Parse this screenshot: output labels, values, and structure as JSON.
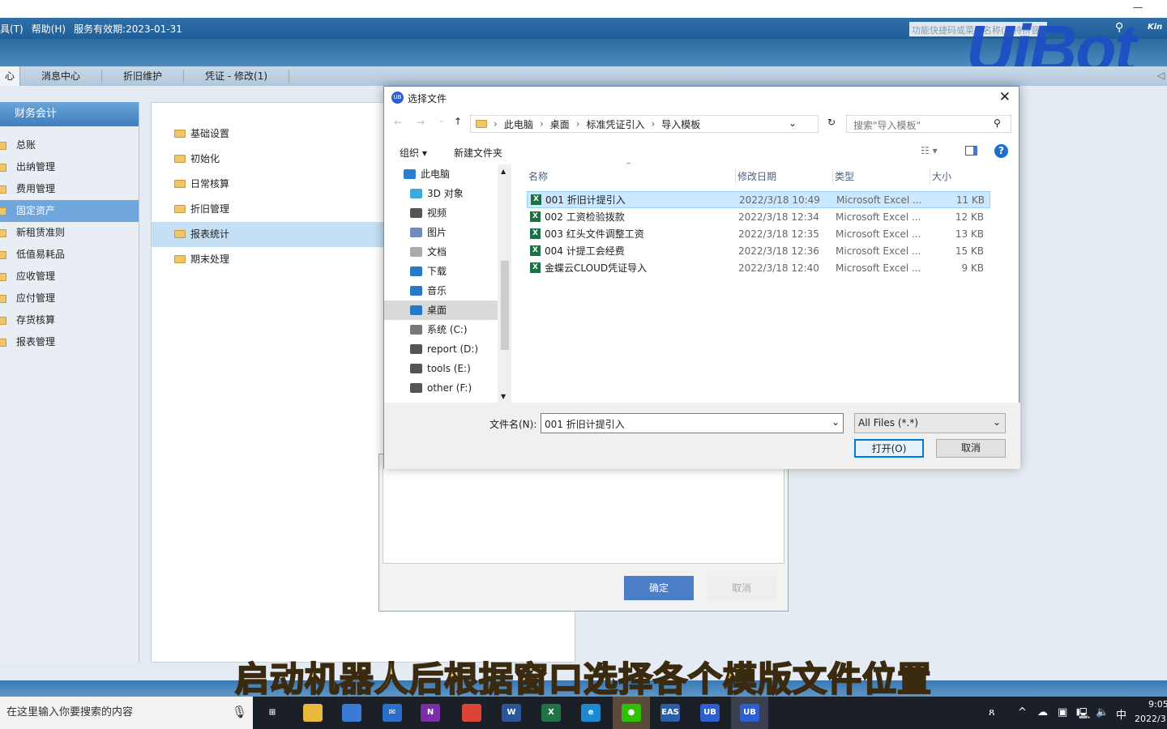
{
  "menubar": {
    "items": [
      "具(T)",
      "帮助(H)",
      "服务有效期:2023-01-31"
    ],
    "search_placeholder": "功能快捷码或菜单名称(支持拼音首字母)",
    "brand": "Kin"
  },
  "watermark": "UiBot",
  "tabs": [
    "心",
    "消息中心",
    "折旧维护",
    "凭证 - 修改(1)"
  ],
  "sidebar": {
    "header": "财务会计",
    "items": [
      "总账",
      "出纳管理",
      "费用管理",
      "固定资产",
      "新租赁准则",
      "低值易耗品",
      "应收管理",
      "应付管理",
      "存货核算",
      "报表管理"
    ],
    "selected": 3
  },
  "midpanel": {
    "items": [
      "基础设置",
      "初始化",
      "日常核算",
      "折旧管理",
      "报表统计",
      "期末处理"
    ],
    "selected": 4
  },
  "back_dialog": {
    "ok": "确定",
    "cancel": "取消"
  },
  "dialog": {
    "title": "选择文件",
    "breadcrumb": [
      "此电脑",
      "桌面",
      "标准凭证引入",
      "导入模板"
    ],
    "search_placeholder": "搜索\"导入模板\"",
    "organize": "组织",
    "new_folder": "新建文件夹",
    "tree": [
      {
        "label": "此电脑",
        "color": "#2b7cd3"
      },
      {
        "label": "3D 对象",
        "color": "#3fa9d8"
      },
      {
        "label": "视频",
        "color": "#555"
      },
      {
        "label": "图片",
        "color": "#6b8fb5"
      },
      {
        "label": "文档",
        "color": "#aaa"
      },
      {
        "label": "下载",
        "color": "#2a78c8"
      },
      {
        "label": "音乐",
        "color": "#2a78c8"
      },
      {
        "label": "桌面",
        "color": "#2a78c8"
      },
      {
        "label": "系统 (C:)",
        "color": "#777"
      },
      {
        "label": "report (D:)",
        "color": "#555"
      },
      {
        "label": "tools (E:)",
        "color": "#555"
      },
      {
        "label": "other (F:)",
        "color": "#555"
      }
    ],
    "tree_selected": 7,
    "columns": [
      "名称",
      "修改日期",
      "类型",
      "大小"
    ],
    "files": [
      {
        "name": "001 折旧计提引入",
        "date": "2022/3/18 10:49",
        "type": "Microsoft Excel ...",
        "size": "11 KB"
      },
      {
        "name": "002 工资检验拨款",
        "date": "2022/3/18 12:34",
        "type": "Microsoft Excel ...",
        "size": "12 KB"
      },
      {
        "name": "003 红头文件调整工资",
        "date": "2022/3/18 12:35",
        "type": "Microsoft Excel ...",
        "size": "13 KB"
      },
      {
        "name": "004 计提工会经费",
        "date": "2022/3/18 12:36",
        "type": "Microsoft Excel ...",
        "size": "15 KB"
      },
      {
        "name": "金蝶云CLOUD凭证导入",
        "date": "2022/3/18 12:40",
        "type": "Microsoft Excel ...",
        "size": "9 KB"
      }
    ],
    "selected_file": 0,
    "filename_label": "文件名(N):",
    "filename_value": "001 折旧计提引入",
    "filetype": "All Files (*.*)",
    "open": "打开(O)",
    "cancel": "取消"
  },
  "caption": "启动机器人后根据窗口选择各个模版文件位置",
  "taskbar": {
    "search_placeholder": "在这里输入你要搜索的内容",
    "apps": [
      {
        "name": "task-view",
        "label": "⊞",
        "color": "#1b1f27"
      },
      {
        "name": "file-explorer",
        "label": "",
        "color": "#e8b93a"
      },
      {
        "name": "store",
        "label": "",
        "color": "#3a7bd5"
      },
      {
        "name": "mail",
        "label": "✉",
        "color": "#2a6fc9"
      },
      {
        "name": "onenote",
        "label": "N",
        "color": "#7a2fa8"
      },
      {
        "name": "chrome",
        "label": "",
        "color": "#db4437"
      },
      {
        "name": "word",
        "label": "W",
        "color": "#2b579a"
      },
      {
        "name": "excel",
        "label": "X",
        "color": "#217346"
      },
      {
        "name": "edge",
        "label": "e",
        "color": "#1c8ad3"
      },
      {
        "name": "wechat",
        "label": "●",
        "color": "#2dc100"
      },
      {
        "name": "eas",
        "label": "EAS",
        "color": "#2b5fa8"
      },
      {
        "name": "uibot",
        "label": "UB",
        "color": "#2d5fd0"
      },
      {
        "name": "uibot-2",
        "label": "UB",
        "color": "#2d5fd0"
      }
    ],
    "ime": "中",
    "time": "9:05",
    "date": "2022/3"
  }
}
